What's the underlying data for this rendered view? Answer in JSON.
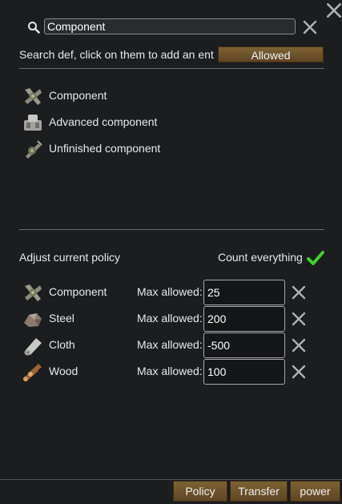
{
  "search": {
    "value": "Component",
    "hint": "Search def, click on them to add an ent",
    "mode_button": "Allowed"
  },
  "defs": [
    {
      "label": "Component",
      "icon": "component-icon"
    },
    {
      "label": "Advanced component",
      "icon": "advanced-component-icon"
    },
    {
      "label": "Unfinished component",
      "icon": "unfinished-component-icon"
    }
  ],
  "policy": {
    "title": "Adjust current policy",
    "count_label": "Count everything",
    "count_everything": true,
    "max_label": "Max allowed:",
    "rows": [
      {
        "name": "Component",
        "value": "25",
        "icon": "component-icon"
      },
      {
        "name": "Steel",
        "value": "200",
        "icon": "steel-icon"
      },
      {
        "name": "Cloth",
        "value": "-500",
        "icon": "cloth-icon"
      },
      {
        "name": "Wood",
        "value": "100",
        "icon": "wood-icon"
      }
    ]
  },
  "tabs": [
    "Policy",
    "Transfer",
    "power"
  ],
  "colors": {
    "accent_button": "#6e5329",
    "check": "#3fd12b",
    "background": "#1c1d1f"
  }
}
